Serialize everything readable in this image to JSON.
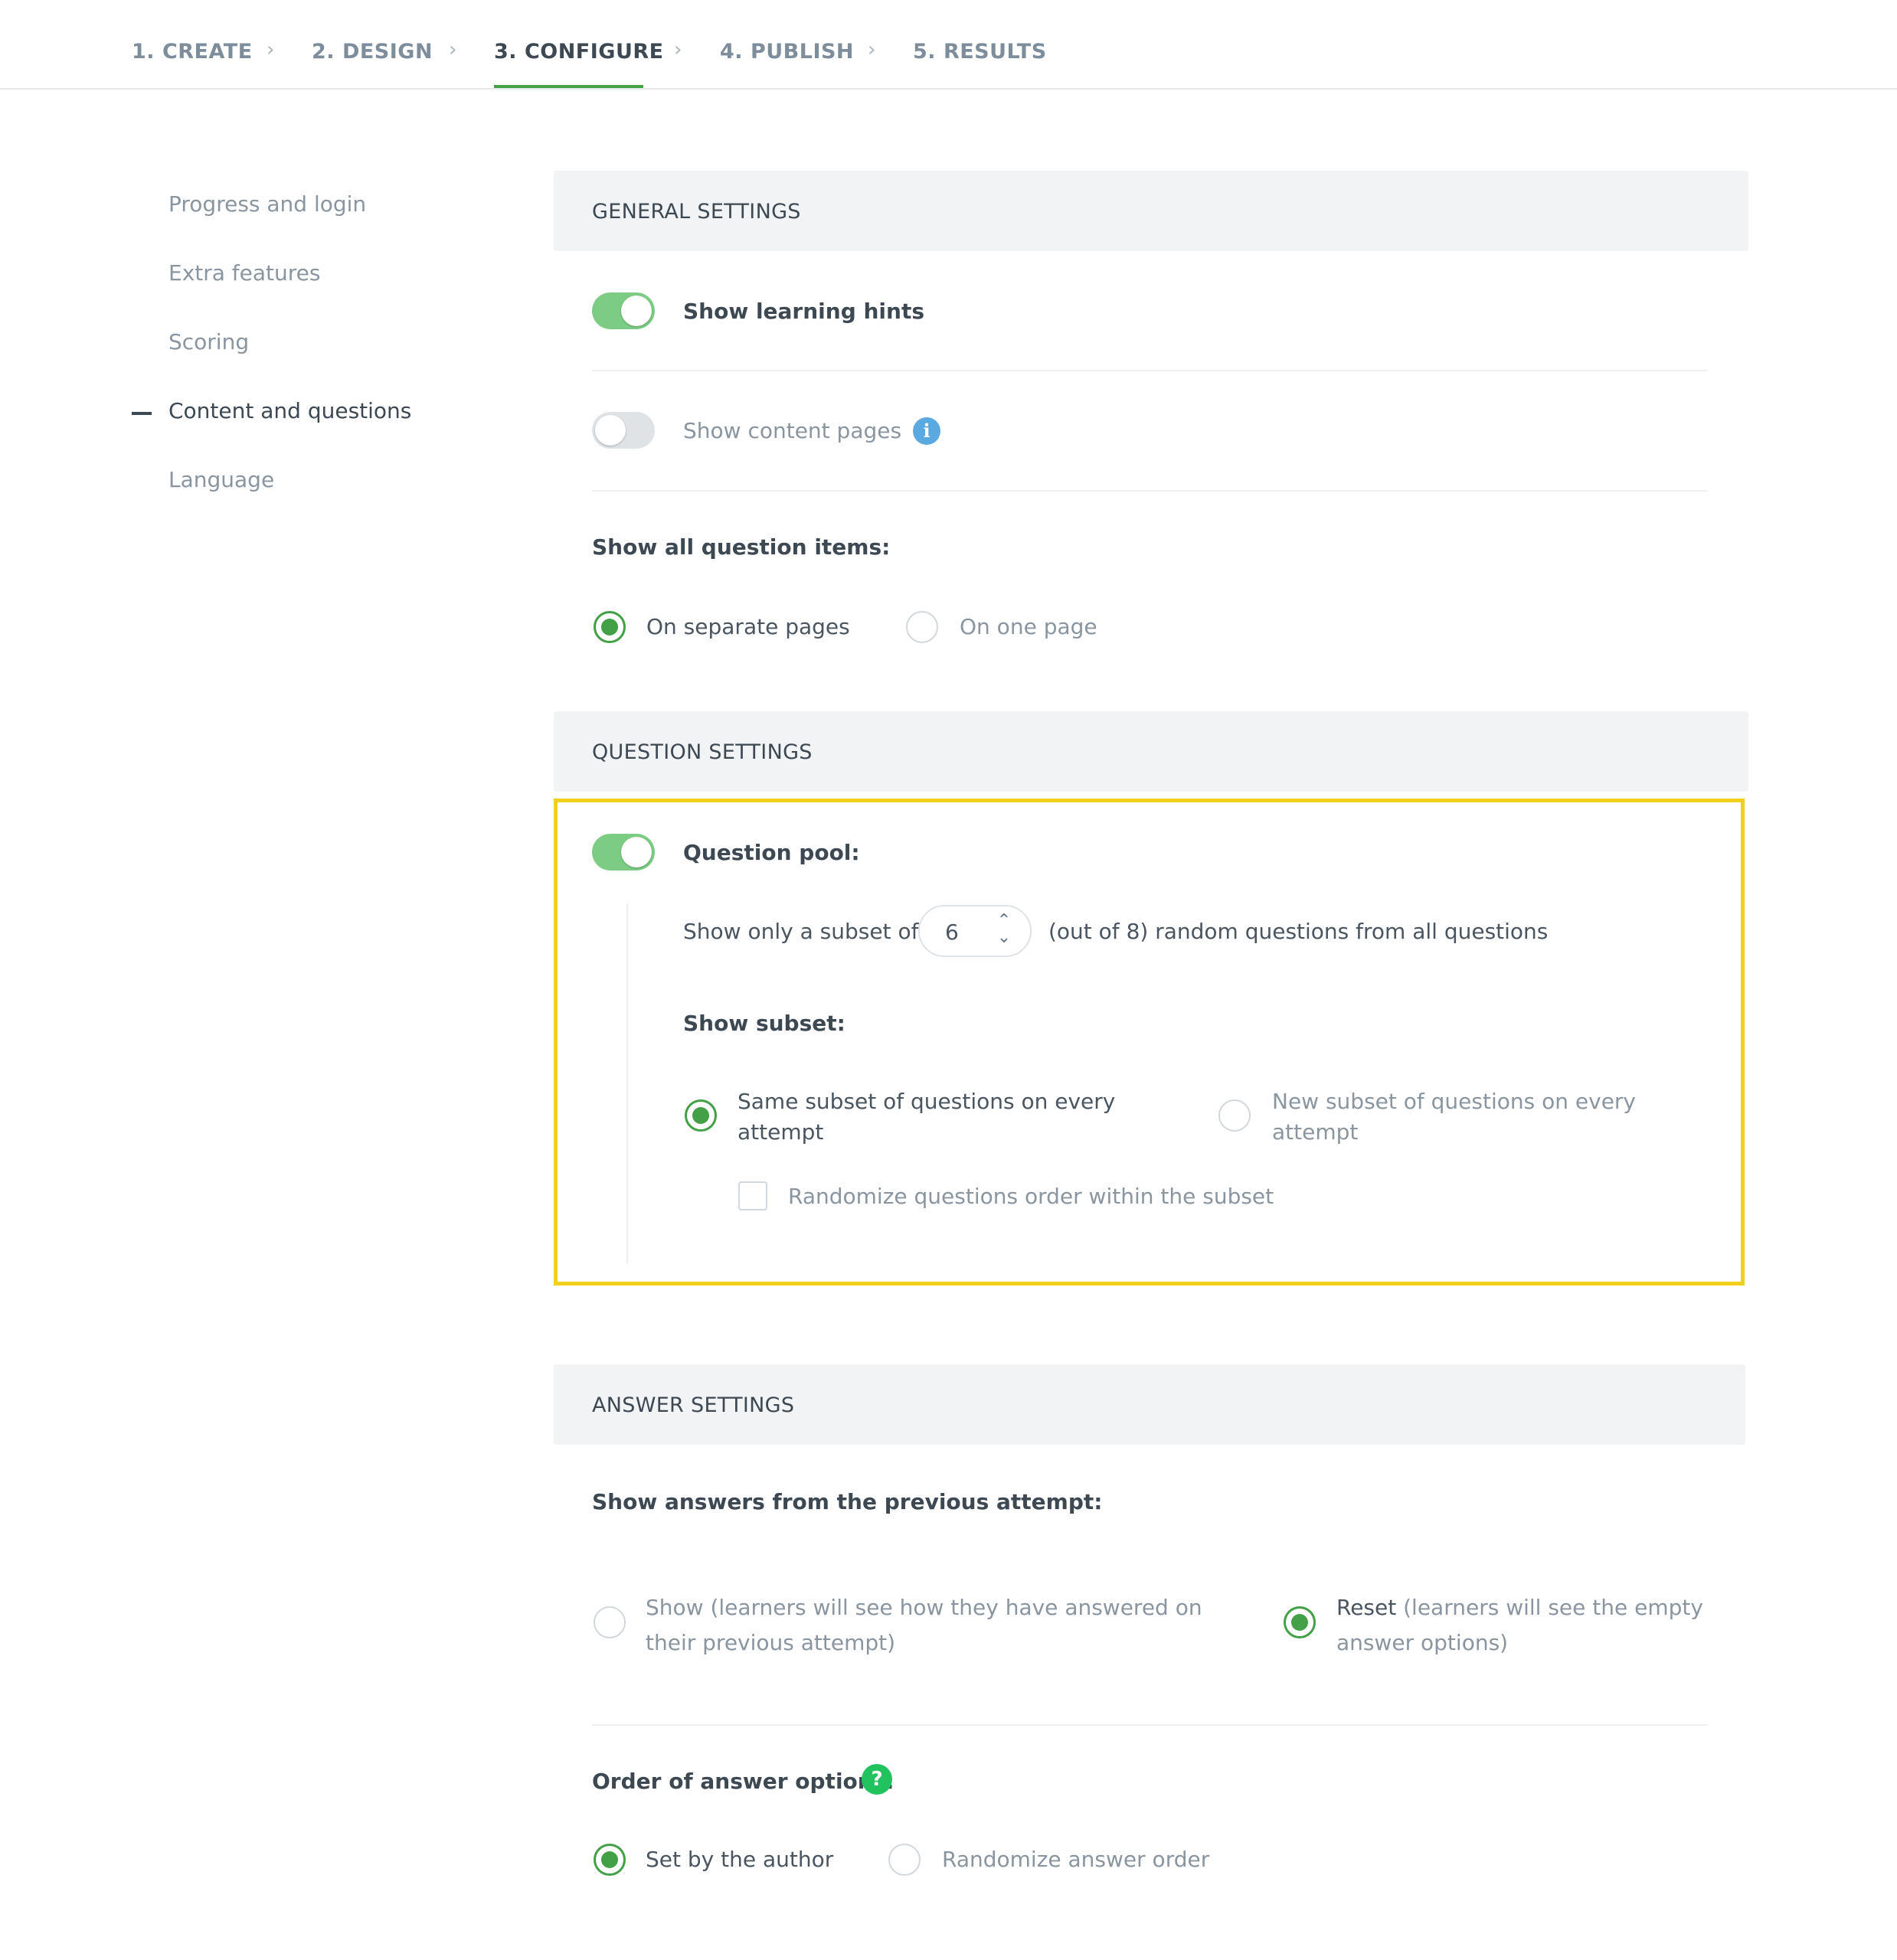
{
  "nav": {
    "steps": [
      {
        "label": "1. CREATE"
      },
      {
        "label": "2. DESIGN"
      },
      {
        "label": "3. CONFIGURE"
      },
      {
        "label": "4. PUBLISH"
      },
      {
        "label": "5. RESULTS"
      }
    ],
    "active_step": "3. CONFIGURE",
    "separator": "›"
  },
  "sidebar": {
    "items": [
      {
        "label": "Progress and login"
      },
      {
        "label": "Extra features"
      },
      {
        "label": "Scoring"
      },
      {
        "label": "Content and questions"
      },
      {
        "label": "Language"
      }
    ],
    "active_item": "Content and questions"
  },
  "general": {
    "title": "GENERAL SETTINGS",
    "learning_hints_label": "Show learning hints",
    "learning_hints_on": true,
    "content_pages_label": "Show content pages",
    "content_pages_on": false,
    "info_glyph": "i",
    "question_items_heading": "Show all question items:",
    "option_separate": "On separate pages",
    "option_one_page": "On one page",
    "selected": "On separate pages"
  },
  "question": {
    "title": "QUESTION SETTINGS",
    "pool_label": "Question pool:",
    "pool_on": true,
    "subset_prefix": "Show only a subset of",
    "subset_value": "6",
    "subset_suffix": "(out of 8) random questions from all questions",
    "show_subset_heading": "Show subset:",
    "same_subset_line1": "Same subset of questions on every",
    "same_subset_line2": "attempt",
    "new_subset_line1": "New subset of questions on every",
    "new_subset_line2": "attempt",
    "selected": "same",
    "randomize_label": "Randomize questions order within the subset",
    "randomize_checked": false
  },
  "answer": {
    "title": "ANSWER SETTINGS",
    "previous_heading": "Show answers from the previous attempt:",
    "show_line1": "Show (learners will see how they have answered on",
    "show_line2": "their previous attempt)",
    "reset_word": "Reset",
    "reset_line1_rest": " (learners will see the empty",
    "reset_line2": "answer options)",
    "selected": "reset",
    "order_heading": "Order of answer options:",
    "help_glyph": "?",
    "option_author": "Set by the author",
    "option_random": "Randomize answer order",
    "order_selected": "Set by the author"
  },
  "colors": {
    "accent_green": "#43a047",
    "toggle_on": "#7ccc84",
    "highlight": "#f2cf1c",
    "info_blue": "#5aa9e0",
    "help_green": "#22c35e"
  }
}
